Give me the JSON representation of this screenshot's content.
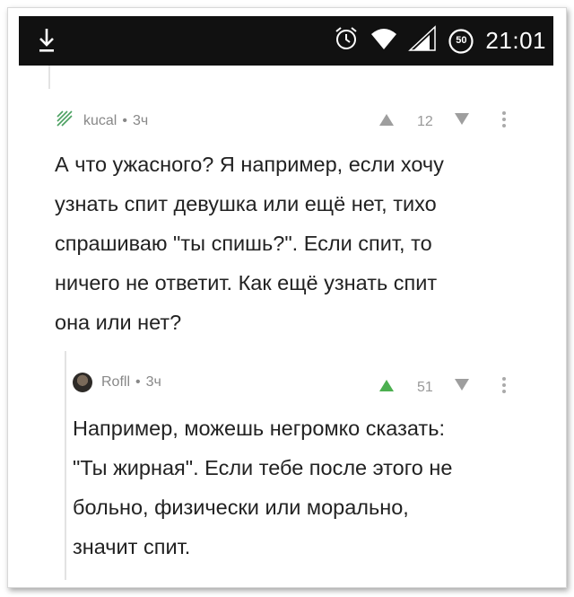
{
  "status_bar": {
    "time": "21:01",
    "battery_level": "50",
    "icons": [
      "download-icon",
      "alarm-icon",
      "wifi-icon",
      "signal-icon",
      "battery-icon"
    ]
  },
  "comments": [
    {
      "author": "kucal",
      "dot": "•",
      "age": "3ч",
      "rating": "12",
      "upvote_color": "#9e9e9e",
      "text_lines": [
        "А что ужасного? Я например, если хочу",
        "узнать спит девушка или ещё нет, тихо",
        "спрашиваю \"ты спишь?\". Если спит, то",
        "ничего не ответит. Как ещё узнать спит",
        "она или нет?"
      ]
    },
    {
      "author": "Rofll",
      "dot": "•",
      "age": "3ч",
      "rating": "51",
      "upvote_color": "#4caf50",
      "text_lines": [
        "Например, можешь негромко сказать:",
        "\"Ты жирная\". Если тебе после этого не",
        "больно, физически или морально,",
        "значит спит."
      ]
    }
  ]
}
